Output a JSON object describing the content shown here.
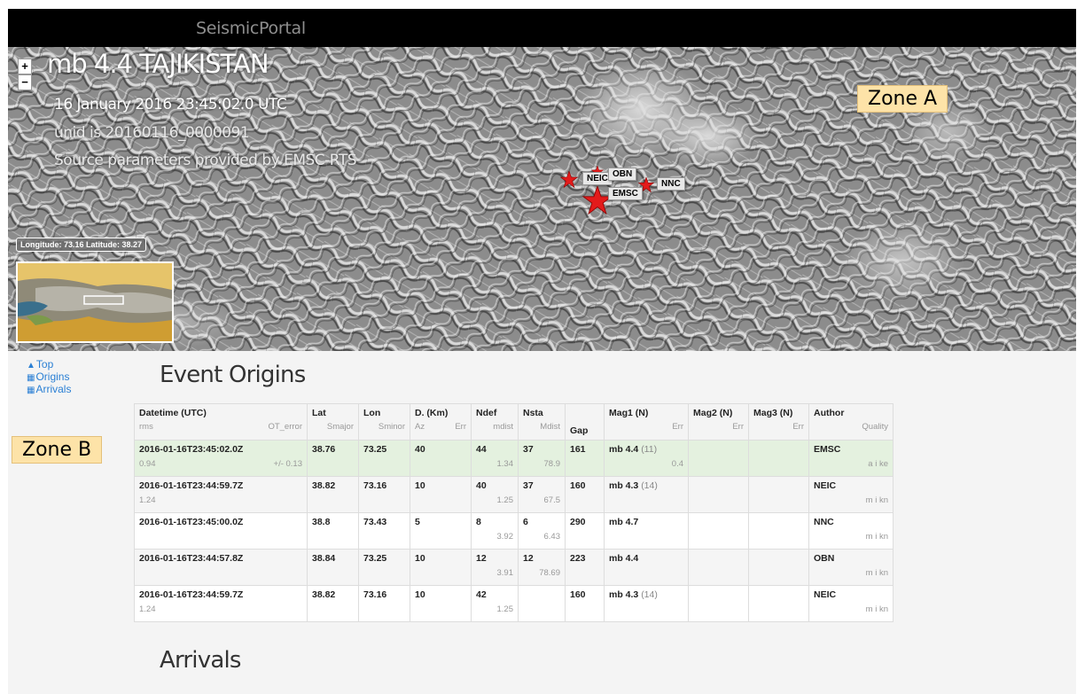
{
  "navbar": {
    "brand": "SeismicPortal"
  },
  "map": {
    "zoom_in": "+",
    "zoom_out": "−",
    "title": "mb 4.4 TAJIKISTAN",
    "date": "16 January 2016 23:45:02.0 UTC",
    "unid": "unid is 20160116_0000091",
    "source": "Source parameters provided by EMSC-RTS",
    "coord_readout": "Longitude: 73.16 Latitude: 38.27",
    "zone_a": "Zone A",
    "markers": [
      "NEIC",
      "OBN",
      "EMSC",
      "NNC"
    ],
    "marker_color": "#e31b1b"
  },
  "sidenav": {
    "top": "Top",
    "origins": "Origins",
    "arrivals": "Arrivals"
  },
  "zone_b": "Zone B",
  "event_origins": {
    "title": "Event Origins",
    "headers": {
      "datetime": "Datetime (UTC)",
      "rms": "rms",
      "ot_error": "OT_error",
      "lat": "Lat",
      "smajor": "Smajor",
      "lon": "Lon",
      "sminor": "Sminor",
      "depth": "D. (Km)",
      "az": "Az",
      "err": "Err",
      "ndef": "Ndef",
      "mdist": "mdist",
      "nsta": "Nsta",
      "Mdist": "Mdist",
      "gap": "Gap",
      "mag1": "Mag1 (N)",
      "mag2": "Mag2 (N)",
      "mag3": "Mag3 (N)",
      "author": "Author",
      "quality": "Quality"
    },
    "rows": [
      {
        "datetime": "2016-01-16T23:45:02.0Z",
        "rms": "0.94",
        "ot_error": "+/- 0.13",
        "lat": "38.76",
        "lon": "73.25",
        "depth": "40",
        "ndef": "44",
        "mdist": "1.34",
        "nsta": "37",
        "Mdist": "78.9",
        "gap": "161",
        "mag1": "mb 4.4",
        "mag1_n": "(11)",
        "mag1_err": "0.4",
        "author": "EMSC",
        "quality": "a i ke"
      },
      {
        "datetime": "2016-01-16T23:44:59.7Z",
        "rms": "1.24",
        "ot_error": "",
        "lat": "38.82",
        "lon": "73.16",
        "depth": "10",
        "ndef": "40",
        "mdist": "1.25",
        "nsta": "37",
        "Mdist": "67.5",
        "gap": "160",
        "mag1": "mb 4.3",
        "mag1_n": "(14)",
        "mag1_err": "",
        "author": "NEIC",
        "quality": "m i kn"
      },
      {
        "datetime": "2016-01-16T23:45:00.0Z",
        "rms": "",
        "ot_error": "",
        "lat": "38.8",
        "lon": "73.43",
        "depth": "5",
        "ndef": "8",
        "mdist": "3.92",
        "nsta": "6",
        "Mdist": "6.43",
        "gap": "290",
        "mag1": "mb 4.7",
        "mag1_n": "",
        "mag1_err": "",
        "author": "NNC",
        "quality": "m i kn"
      },
      {
        "datetime": "2016-01-16T23:44:57.8Z",
        "rms": "",
        "ot_error": "",
        "lat": "38.84",
        "lon": "73.25",
        "depth": "10",
        "ndef": "12",
        "mdist": "3.91",
        "nsta": "12",
        "Mdist": "78.69",
        "gap": "223",
        "mag1": "mb 4.4",
        "mag1_n": "",
        "mag1_err": "",
        "author": "OBN",
        "quality": "m i kn"
      },
      {
        "datetime": "2016-01-16T23:44:59.7Z",
        "rms": "1.24",
        "ot_error": "",
        "lat": "38.82",
        "lon": "73.16",
        "depth": "10",
        "ndef": "42",
        "mdist": "1.25",
        "nsta": "",
        "Mdist": "",
        "gap": "160",
        "mag1": "mb 4.3",
        "mag1_n": "(14)",
        "mag1_err": "",
        "author": "NEIC",
        "quality": "m i kn"
      }
    ]
  },
  "arrivals": {
    "title": "Arrivals"
  }
}
